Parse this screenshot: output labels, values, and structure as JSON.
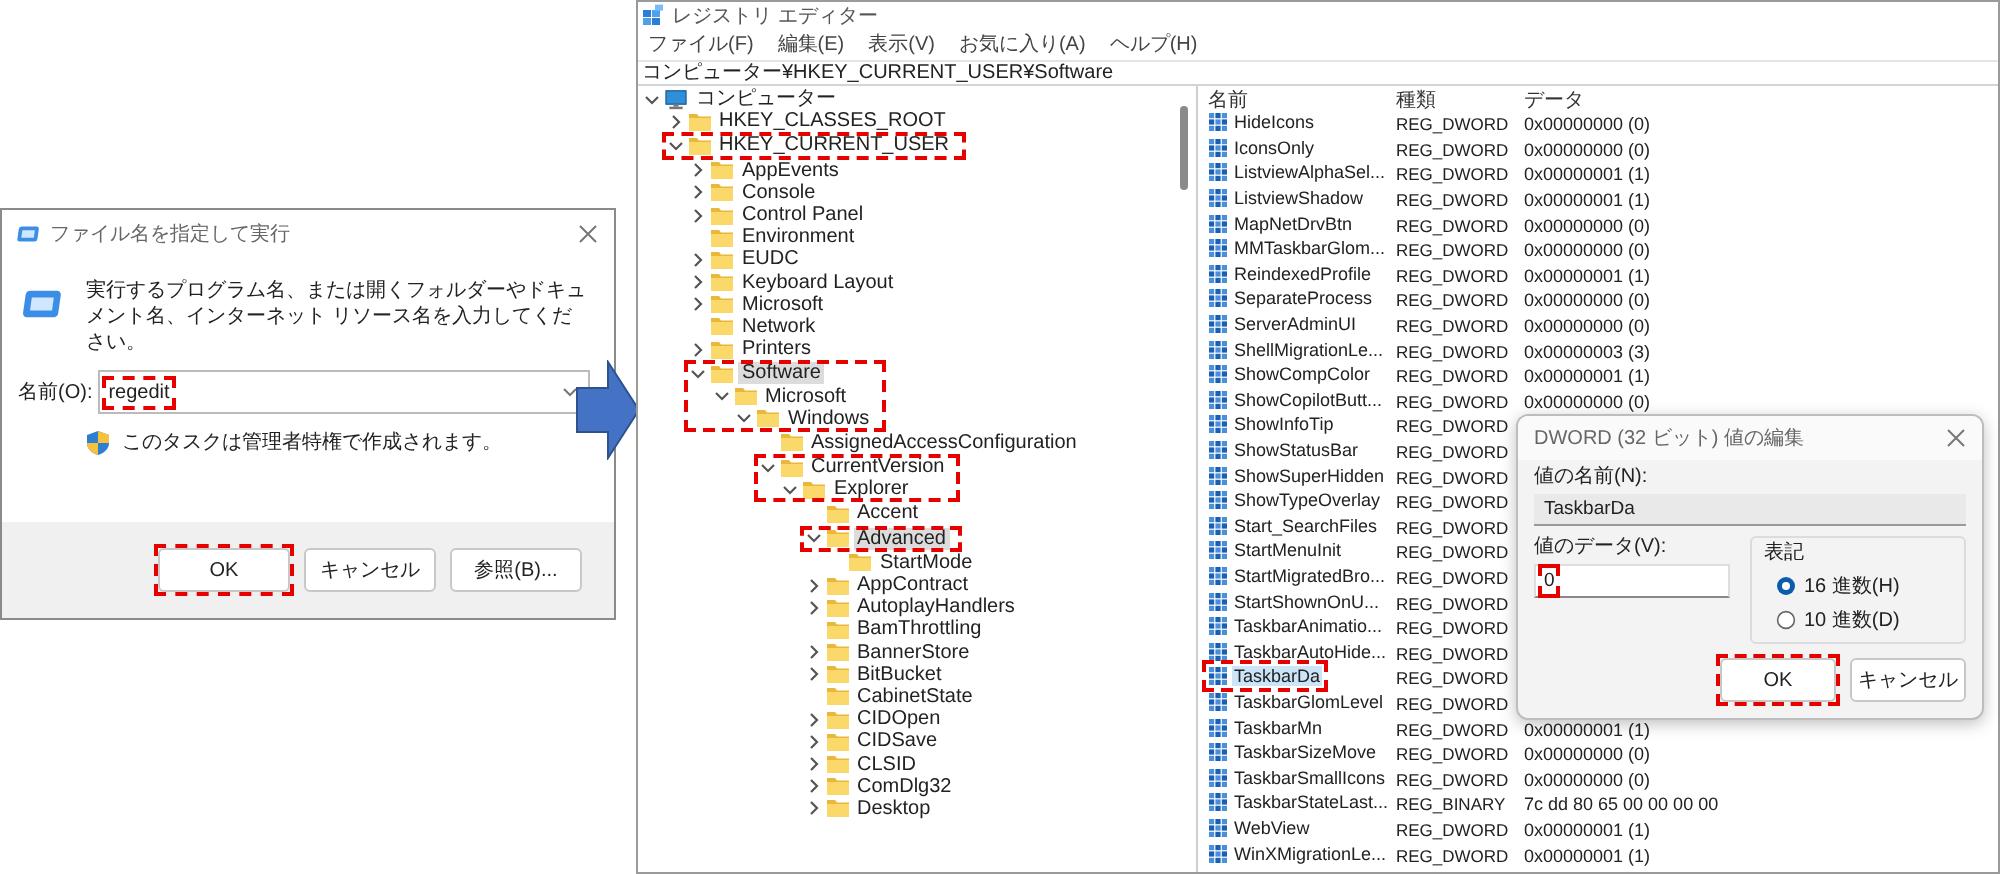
{
  "run_dialog": {
    "title": "ファイル名を指定して実行",
    "message": "実行するプログラム名、または開くフォルダーやドキュメント名、インターネット リソース名を入力してください。",
    "name_label": "名前(O):",
    "name_field": {
      "value": "regedit",
      "annotated": true
    },
    "admin_note": "このタスクは管理者特権で作成されます。",
    "buttons": [
      {
        "label": "OK",
        "annotated": true
      },
      {
        "label": "キャンセル"
      },
      {
        "label": "参照(B)..."
      }
    ]
  },
  "registry_editor": {
    "title": "レジストリ エディター",
    "menu": [
      "ファイル(F)",
      "編集(E)",
      "表示(V)",
      "お気に入り(A)",
      "ヘルプ(H)"
    ],
    "address": "コンピューター¥HKEY_CURRENT_USER¥Software",
    "tree": [
      {
        "label": "コンピューター",
        "kind": "computer",
        "expanded": true,
        "selected": false,
        "children": [
          {
            "label": "HKEY_CLASSES_ROOT",
            "kind": "folder",
            "expanded": false,
            "selected": false
          },
          {
            "label": "HKEY_CURRENT_USER",
            "kind": "folder",
            "expanded": true,
            "selected": false,
            "annotated": true,
            "children": [
              {
                "label": "AppEvents",
                "kind": "folder",
                "expanded": false,
                "selected": false
              },
              {
                "label": "Console",
                "kind": "folder",
                "expanded": false,
                "selected": false
              },
              {
                "label": "Control Panel",
                "kind": "folder",
                "expanded": false,
                "selected": false
              },
              {
                "label": "Environment",
                "kind": "folder",
                "selected": false
              },
              {
                "label": "EUDC",
                "kind": "folder",
                "expanded": false,
                "selected": false
              },
              {
                "label": "Keyboard Layout",
                "kind": "folder",
                "expanded": false,
                "selected": false
              },
              {
                "label": "Microsoft",
                "kind": "folder",
                "expanded": false,
                "selected": false
              },
              {
                "label": "Network",
                "kind": "folder",
                "selected": false
              },
              {
                "label": "Printers",
                "kind": "folder",
                "expanded": false,
                "selected": false
              },
              {
                "label": "Software",
                "kind": "folder",
                "expanded": true,
                "selected": true,
                "annotated": true,
                "children": [
                  {
                    "label": "Microsoft",
                    "kind": "folder",
                    "expanded": true,
                    "selected": false,
                    "annotated": true,
                    "children": [
                      {
                        "label": "Windows",
                        "kind": "folder",
                        "expanded": true,
                        "selected": false,
                        "annotated": true,
                        "children": [
                          {
                            "label": "AssignedAccessConfiguration",
                            "kind": "folder",
                            "selected": false
                          },
                          {
                            "label": "CurrentVersion",
                            "kind": "folder",
                            "expanded": true,
                            "selected": false,
                            "annotated": true,
                            "children": [
                              {
                                "label": "Explorer",
                                "kind": "folder",
                                "expanded": true,
                                "selected": false,
                                "annotated": true,
                                "children": [
                                  {
                                    "label": "Accent",
                                    "kind": "folder",
                                    "selected": false
                                  },
                                  {
                                    "label": "Advanced",
                                    "kind": "folder",
                                    "expanded": true,
                                    "selected": true,
                                    "annotated": true,
                                    "children": [
                                      {
                                        "label": "StartMode",
                                        "kind": "folder",
                                        "selected": false
                                      }
                                    ]
                                  },
                                  {
                                    "label": "AppContract",
                                    "kind": "folder",
                                    "expanded": false,
                                    "selected": false
                                  },
                                  {
                                    "label": "AutoplayHandlers",
                                    "kind": "folder",
                                    "expanded": false,
                                    "selected": false
                                  },
                                  {
                                    "label": "BamThrottling",
                                    "kind": "folder",
                                    "selected": false
                                  },
                                  {
                                    "label": "BannerStore",
                                    "kind": "folder",
                                    "expanded": false,
                                    "selected": false
                                  },
                                  {
                                    "label": "BitBucket",
                                    "kind": "folder",
                                    "expanded": false,
                                    "selected": false
                                  },
                                  {
                                    "label": "CabinetState",
                                    "kind": "folder",
                                    "selected": false
                                  },
                                  {
                                    "label": "CIDOpen",
                                    "kind": "folder",
                                    "expanded": false,
                                    "selected": false
                                  },
                                  {
                                    "label": "CIDSave",
                                    "kind": "folder",
                                    "expanded": false,
                                    "selected": false
                                  },
                                  {
                                    "label": "CLSID",
                                    "kind": "folder",
                                    "expanded": false,
                                    "selected": false
                                  },
                                  {
                                    "label": "ComDlg32",
                                    "kind": "folder",
                                    "expanded": false,
                                    "selected": false
                                  },
                                  {
                                    "label": "Desktop",
                                    "kind": "folder",
                                    "expanded": false,
                                    "selected": false
                                  }
                                ]
                              }
                            ]
                          }
                        ]
                      }
                    ]
                  }
                ]
              }
            ]
          }
        ]
      }
    ],
    "columns": [
      "名前",
      "種類",
      "データ"
    ],
    "values": [
      {
        "name": "HideIcons",
        "type": "REG_DWORD",
        "data": "0x00000000 (0)",
        "selected": false
      },
      {
        "name": "IconsOnly",
        "type": "REG_DWORD",
        "data": "0x00000000 (0)",
        "selected": false
      },
      {
        "name": "ListviewAlphaSel...",
        "type": "REG_DWORD",
        "data": "0x00000001 (1)",
        "selected": false
      },
      {
        "name": "ListviewShadow",
        "type": "REG_DWORD",
        "data": "0x00000001 (1)",
        "selected": false
      },
      {
        "name": "MapNetDrvBtn",
        "type": "REG_DWORD",
        "data": "0x00000000 (0)",
        "selected": false
      },
      {
        "name": "MMTaskbarGlom...",
        "type": "REG_DWORD",
        "data": "0x00000000 (0)",
        "selected": false
      },
      {
        "name": "ReindexedProfile",
        "type": "REG_DWORD",
        "data": "0x00000001 (1)",
        "selected": false
      },
      {
        "name": "SeparateProcess",
        "type": "REG_DWORD",
        "data": "0x00000000 (0)",
        "selected": false
      },
      {
        "name": "ServerAdminUI",
        "type": "REG_DWORD",
        "data": "0x00000000 (0)",
        "selected": false
      },
      {
        "name": "ShellMigrationLe...",
        "type": "REG_DWORD",
        "data": "0x00000003 (3)",
        "selected": false
      },
      {
        "name": "ShowCompColor",
        "type": "REG_DWORD",
        "data": "0x00000001 (1)",
        "selected": false
      },
      {
        "name": "ShowCopilotButt...",
        "type": "REG_DWORD",
        "data": "0x00000000 (0)",
        "selected": false
      },
      {
        "name": "ShowInfoTip",
        "type": "REG_DWORD",
        "selected": false
      },
      {
        "name": "ShowStatusBar",
        "type": "REG_DWORD",
        "selected": false
      },
      {
        "name": "ShowSuperHidden",
        "type": "REG_DWORD",
        "selected": false
      },
      {
        "name": "ShowTypeOverlay",
        "type": "REG_DWORD",
        "selected": false
      },
      {
        "name": "Start_SearchFiles",
        "type": "REG_DWORD",
        "selected": false
      },
      {
        "name": "StartMenuInit",
        "type": "REG_DWORD",
        "selected": false
      },
      {
        "name": "StartMigratedBro...",
        "type": "REG_DWORD",
        "selected": false
      },
      {
        "name": "StartShownOnU...",
        "type": "REG_DWORD",
        "selected": false
      },
      {
        "name": "TaskbarAnimatio...",
        "type": "REG_DWORD",
        "selected": false
      },
      {
        "name": "TaskbarAutoHide...",
        "type": "REG_DWORD",
        "selected": false
      },
      {
        "name": "TaskbarDa",
        "type": "REG_DWORD",
        "selected": true,
        "annotated": true
      },
      {
        "name": "TaskbarGlomLevel",
        "type": "REG_DWORD",
        "selected": false
      },
      {
        "name": "TaskbarMn",
        "type": "REG_DWORD",
        "data": "0x00000001 (1)",
        "selected": false
      },
      {
        "name": "TaskbarSizeMove",
        "type": "REG_DWORD",
        "data": "0x00000000 (0)",
        "selected": false
      },
      {
        "name": "TaskbarSmallIcons",
        "type": "REG_DWORD",
        "data": "0x00000000 (0)",
        "selected": false
      },
      {
        "name": "TaskbarStateLast...",
        "type": "REG_BINARY",
        "data": "7c dd 80 65 00 00 00 00",
        "selected": false
      },
      {
        "name": "WebView",
        "type": "REG_DWORD",
        "data": "0x00000001 (1)",
        "selected": false
      },
      {
        "name": "WinXMigrationLe...",
        "type": "REG_DWORD",
        "data": "0x00000001 (1)",
        "selected": false
      }
    ]
  },
  "dword_dialog": {
    "title": "DWORD (32 ビット) 値の編集",
    "name_label": "値の名前(N):",
    "name_value": "TaskbarDa",
    "data_label": "値のデータ(V):",
    "data_field": {
      "value": "0",
      "annotated": true
    },
    "base_label": "表記",
    "bases": [
      {
        "label": "16 進数(H)",
        "selected": true
      },
      {
        "label": "10 進数(D)",
        "selected": false
      }
    ],
    "buttons": [
      {
        "label": "OK",
        "annotated": true
      },
      {
        "label": "キャンセル"
      }
    ]
  }
}
